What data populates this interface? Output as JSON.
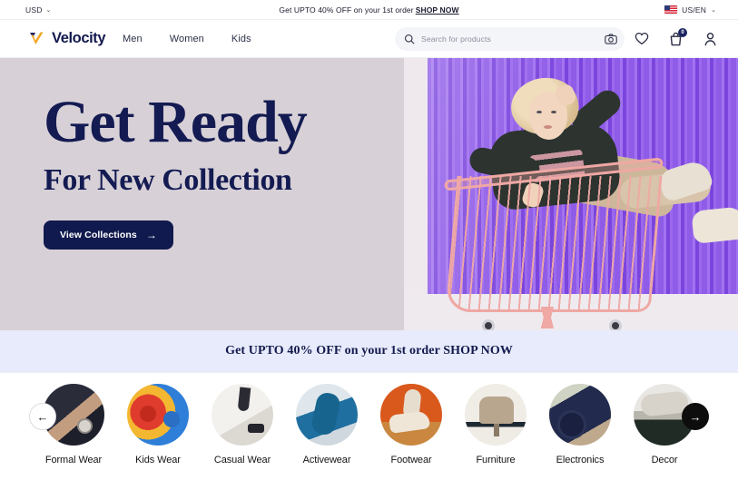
{
  "topbar": {
    "currency": "USD",
    "currency_caret": "⌄",
    "promo_prefix": "Get UPTO 40% OFF on your 1st order",
    "promo_link": "SHOP NOW",
    "locale": "US/EN",
    "locale_caret": "⌄",
    "flag_icon": "us-flag-icon"
  },
  "header": {
    "brand_name": "Velocity",
    "logo_icon": "velocity-checkmark-logo",
    "nav": [
      {
        "label": "Men"
      },
      {
        "label": "Women"
      },
      {
        "label": "Kids"
      }
    ],
    "search": {
      "placeholder": "Search for products",
      "value": "",
      "search_icon": "search-icon",
      "camera_icon": "camera-icon"
    },
    "icons": {
      "wishlist": "heart-icon",
      "cart": "shopping-bag-icon",
      "account": "user-icon"
    },
    "cart_badge_count": "0"
  },
  "hero": {
    "title": "Get Ready",
    "subtitle": "For New Collection",
    "cta_label": "View Collections",
    "cta_arrow": "→",
    "background_color": "#d7d1d7",
    "accent_color": "#111a4e",
    "image_alt": "woman-in-shopping-cart-photo"
  },
  "promo_strip": {
    "text": "Get UPTO 40% OFF on your 1st order SHOP NOW",
    "background_color": "#e7ebfb"
  },
  "categories": {
    "prev_arrow": "←",
    "next_arrow": "→",
    "items": [
      {
        "label": "Formal Wear",
        "art": "c-formal"
      },
      {
        "label": "Kids Wear",
        "art": "c-kids"
      },
      {
        "label": "Casual Wear",
        "art": "c-casual"
      },
      {
        "label": "Activewear",
        "art": "c-active"
      },
      {
        "label": "Footwear",
        "art": "c-foot"
      },
      {
        "label": "Furniture",
        "art": "c-furn"
      },
      {
        "label": "Electronics",
        "art": "c-elec"
      },
      {
        "label": "Decor",
        "art": "c-decor"
      }
    ]
  }
}
